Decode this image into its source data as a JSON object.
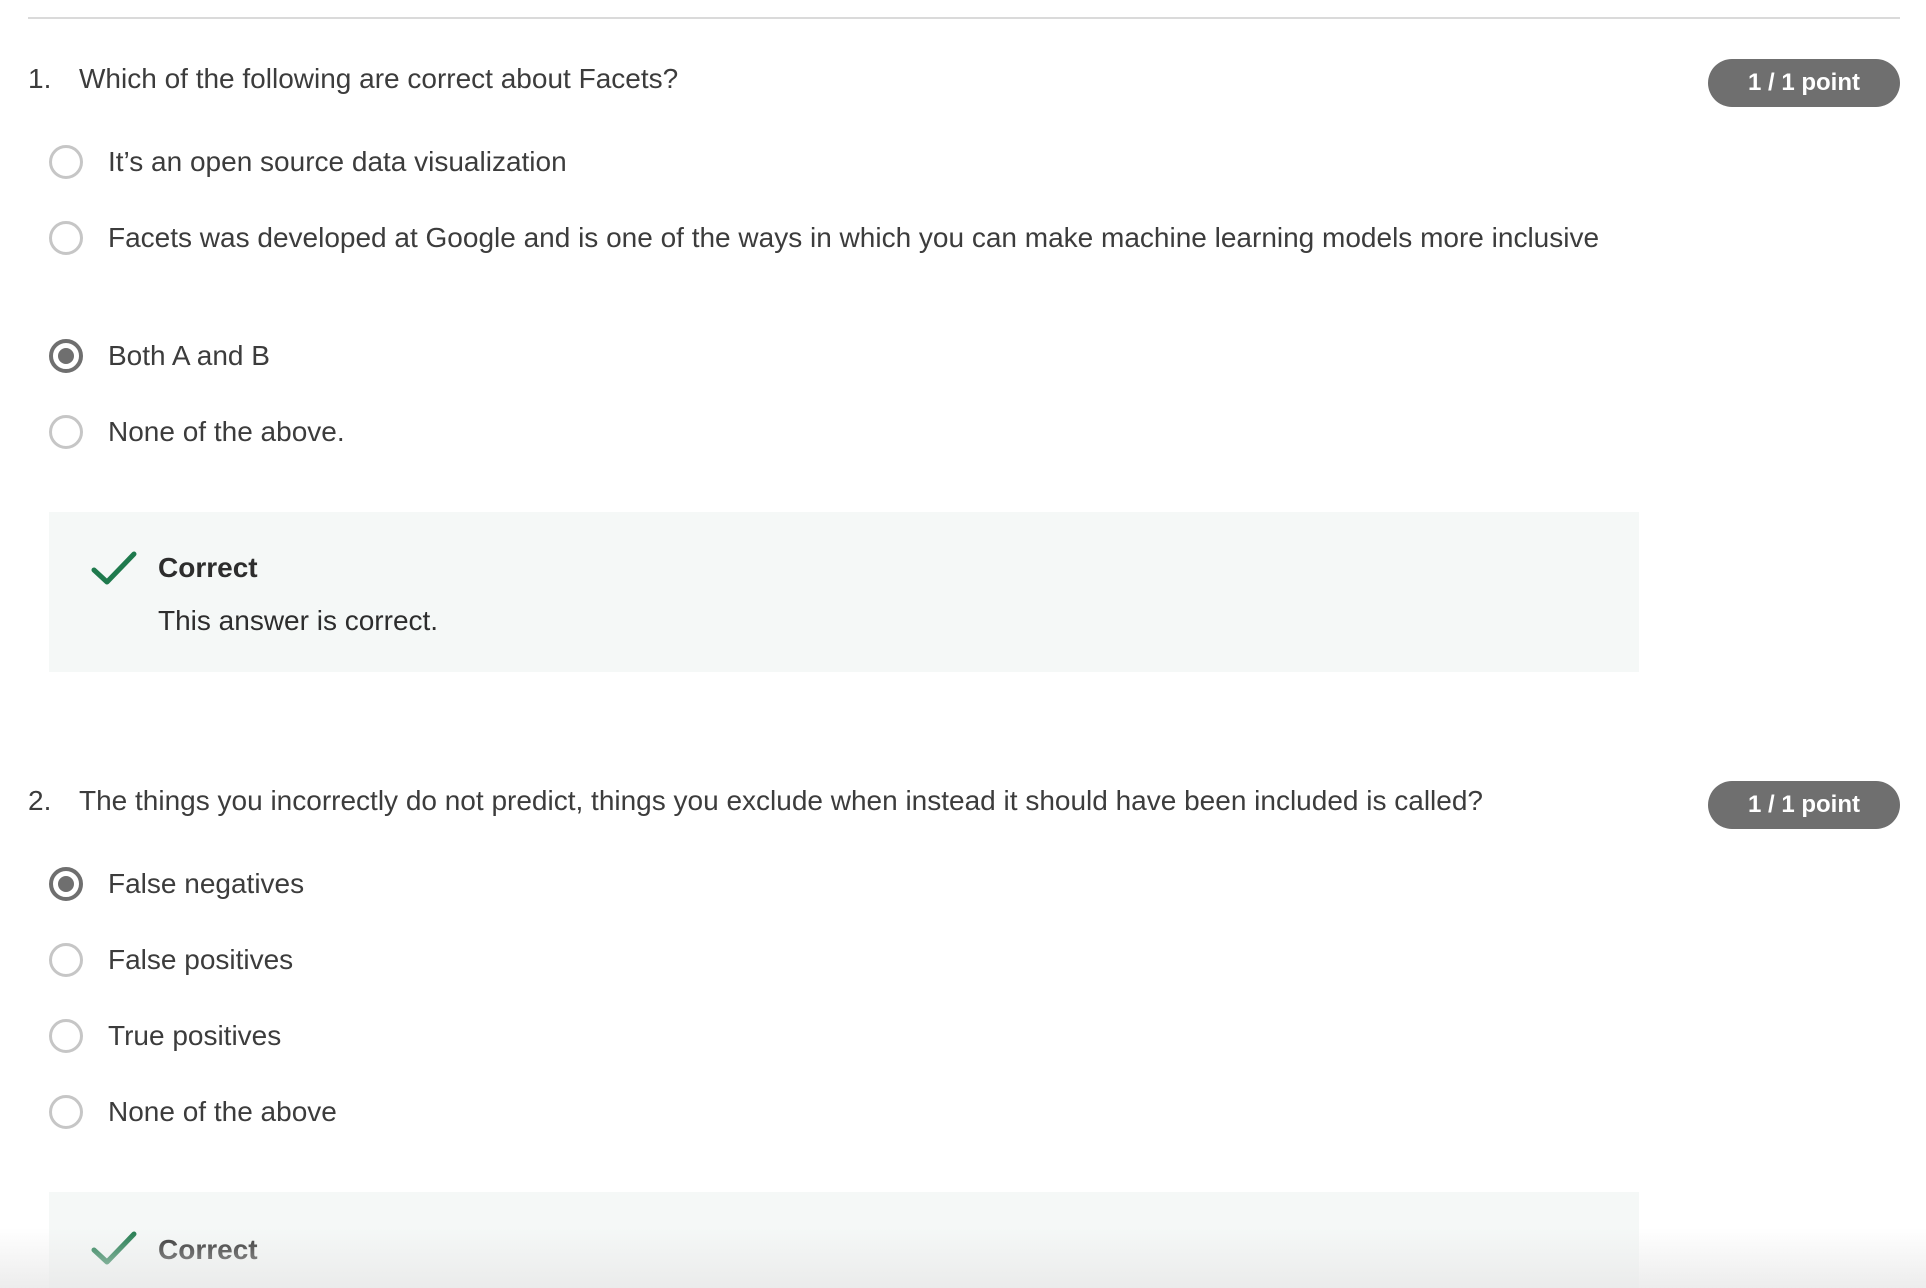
{
  "questions": [
    {
      "number": "1.",
      "prompt": "Which of the following are correct about Facets?",
      "points": "1 / 1 point",
      "options": [
        {
          "label": "It’s an open source data visualization",
          "selected": false
        },
        {
          "label": "Facets was developed at Google and is one of the ways in which you can make machine learning models more inclusive",
          "selected": false
        },
        {
          "label": "Both A and B",
          "selected": true
        },
        {
          "label": "None of the above.",
          "selected": false
        }
      ],
      "feedback": {
        "icon": "check-icon",
        "title": "Correct",
        "text": "This answer is correct."
      }
    },
    {
      "number": "2.",
      "prompt": "The things you incorrectly do not predict, things you exclude when instead it should have been included is called?",
      "points": "1 / 1 point",
      "options": [
        {
          "label": "False negatives",
          "selected": true
        },
        {
          "label": "False positives",
          "selected": false
        },
        {
          "label": "True positives",
          "selected": false
        },
        {
          "label": "None of the above",
          "selected": false
        }
      ],
      "feedback": {
        "icon": "check-icon",
        "title": "Correct",
        "text": ""
      }
    }
  ],
  "colors": {
    "check": "#1f7a4d",
    "points_badge": "#6f6f6f",
    "feedback_bg": "#f5f8f7"
  }
}
